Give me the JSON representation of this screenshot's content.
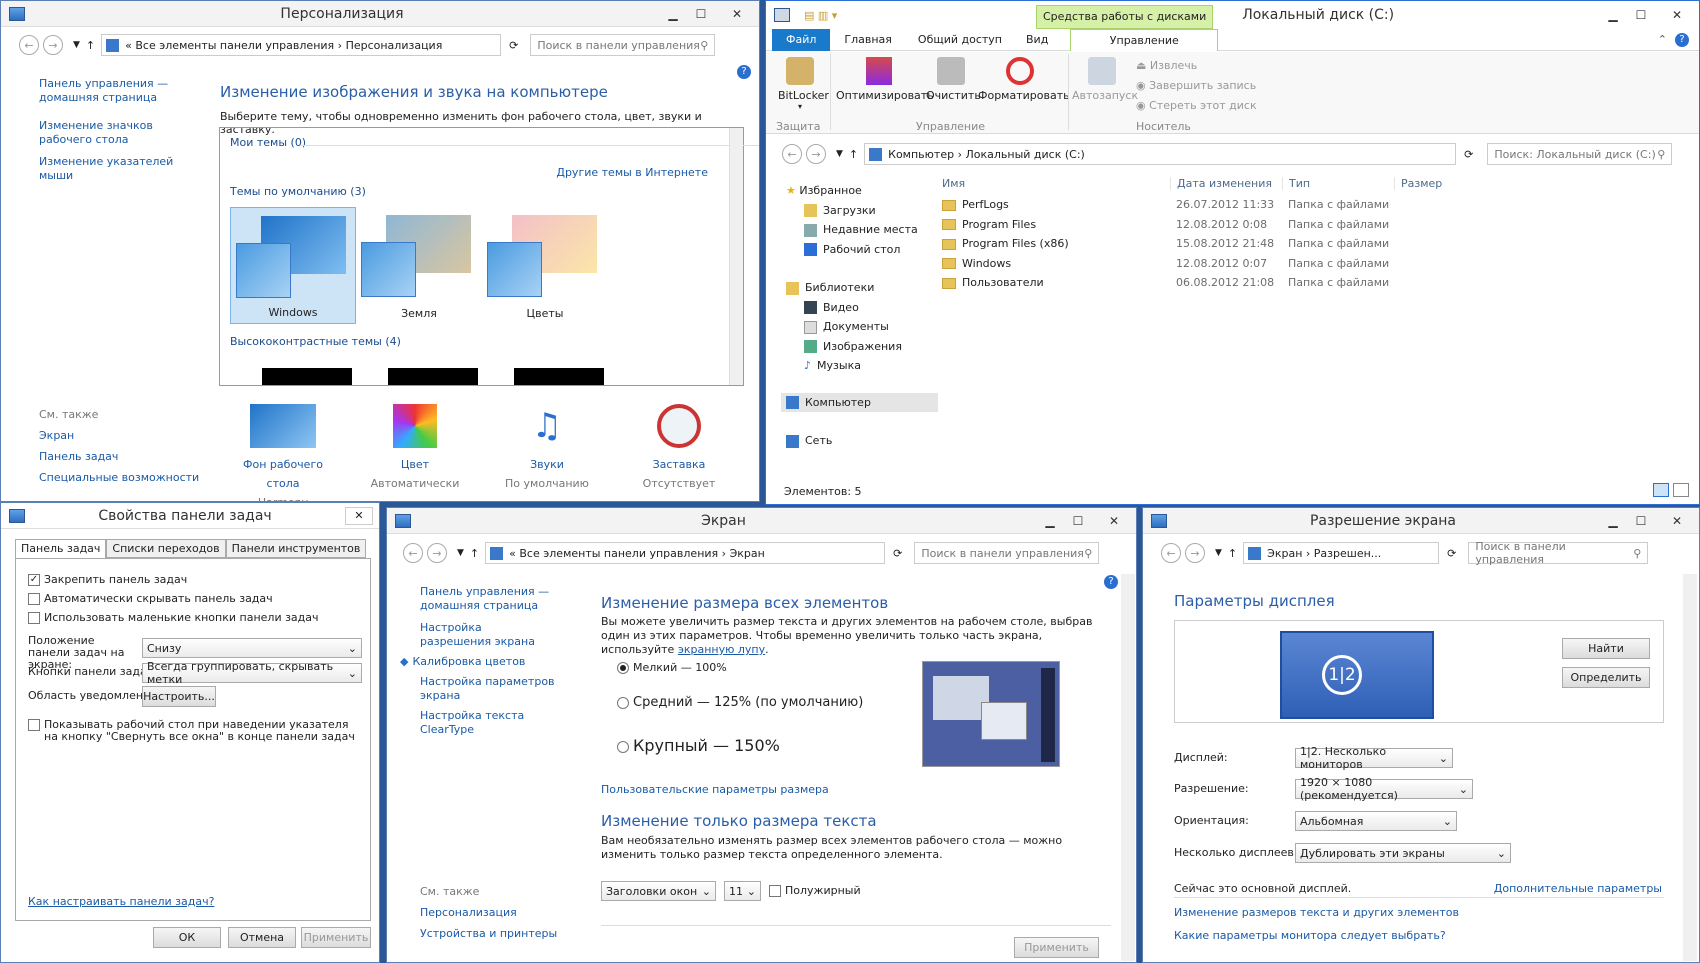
{
  "personalization": {
    "title": "Персонализация",
    "breadcrumb": [
      "Все элементы панели управления",
      "Персонализация"
    ],
    "search_placeholder": "Поиск в панели управления",
    "left_links": [
      "Панель управления — домашняя страница",
      "Изменение значков рабочего стола",
      "Изменение указателей мыши"
    ],
    "see_also_title": "См. также",
    "see_also": [
      "Экран",
      "Панель задач",
      "Специальные возможности"
    ],
    "heading": "Изменение изображения и звука на компьютере",
    "subheading": "Выберите тему, чтобы одновременно изменить фон рабочего стола, цвет, звуки и заставку.",
    "my_themes": "Мои темы (0)",
    "more_online": "Другие темы в Интернете",
    "default_themes": "Темы по умолчанию (3)",
    "themes": [
      "Windows",
      "Земля",
      "Цветы"
    ],
    "high_contrast": "Высококонтрастные темы (4)",
    "bottom_items": [
      {
        "label": "Фон рабочего стола",
        "value": "Harmony"
      },
      {
        "label": "Цвет",
        "value": "Автоматически"
      },
      {
        "label": "Звуки",
        "value": "По умолчанию"
      },
      {
        "label": "Заставка",
        "value": "Отсутствует"
      }
    ]
  },
  "explorer": {
    "title": "Локальный диск (C:)",
    "context_tab": "Средства работы с дисками",
    "tabs": [
      "Файл",
      "Главная",
      "Общий доступ",
      "Вид",
      "Управление"
    ],
    "ribbon": {
      "bitlocker": "BitLocker",
      "optimize": "Оптимизировать",
      "cleanup": "Очистить",
      "format": "Форматировать",
      "autoplay": "Автозапуск",
      "eject": "Извлечь",
      "finish_burn": "Завершить запись",
      "erase": "Стереть этот диск",
      "group_protect": "Защита",
      "group_manage": "Управление",
      "group_media": "Носитель"
    },
    "breadcrumb": [
      "Компьютер",
      "Локальный диск (C:)"
    ],
    "search_placeholder": "Поиск: Локальный диск (C:)",
    "nav": {
      "favorites": "Избранное",
      "fav_items": [
        "Загрузки",
        "Недавние места",
        "Рабочий стол"
      ],
      "libraries": "Библиотеки",
      "lib_items": [
        "Видео",
        "Документы",
        "Изображения",
        "Музыка"
      ],
      "computer": "Компьютер",
      "network": "Сеть"
    },
    "columns": [
      "Имя",
      "Дата изменения",
      "Тип",
      "Размер"
    ],
    "rows": [
      {
        "name": "PerfLogs",
        "date": "26.07.2012 11:33",
        "type": "Папка с файлами"
      },
      {
        "name": "Program Files",
        "date": "12.08.2012 0:08",
        "type": "Папка с файлами"
      },
      {
        "name": "Program Files (x86)",
        "date": "15.08.2012 21:48",
        "type": "Папка с файлами"
      },
      {
        "name": "Windows",
        "date": "12.08.2012 0:07",
        "type": "Папка с файлами"
      },
      {
        "name": "Пользователи",
        "date": "06.08.2012 21:08",
        "type": "Папка с файлами"
      }
    ],
    "status": "Элементов: 5"
  },
  "taskbar_props": {
    "title": "Свойства панели задач",
    "tabs": [
      "Панель задач",
      "Списки переходов",
      "Панели инструментов"
    ],
    "chk_lock": "Закрепить панель задач",
    "chk_autohide": "Автоматически скрывать панель задач",
    "chk_small": "Использовать маленькие кнопки панели задач",
    "position_label": "Положение панели задач на экране:",
    "position_value": "Снизу",
    "buttons_label": "Кнопки панели задач:",
    "buttons_value": "Всегда группировать, скрывать метки",
    "notify_label": "Область уведомлений:",
    "notify_button": "Настроить...",
    "peek_label": "Показывать рабочий стол при наведении указателя на кнопку \"Свернуть все окна\" в конце панели задач",
    "help_link": "Как настраивать панели задач?",
    "ok": "ОК",
    "cancel": "Отмена",
    "apply": "Применить"
  },
  "display": {
    "title": "Экран",
    "breadcrumb": [
      "Все элементы панели управления",
      "Экран"
    ],
    "search_placeholder": "Поиск в панели управления",
    "left_links": [
      "Панель управления — домашняя страница",
      "Настройка разрешения экрана",
      "Калибровка цветов",
      "Настройка параметров экрана",
      "Настройка текста ClearType"
    ],
    "see_also_title": "См. также",
    "see_also": [
      "Персонализация",
      "Устройства и принтеры"
    ],
    "heading1": "Изменение размера всех элементов",
    "desc1": "Вы можете увеличить размер текста и других элементов на рабочем столе, выбрав один из этих параметров. Чтобы временно увеличить только часть экрана, используйте",
    "magnifier_link": "экранную лупу",
    "opt_small": "Мелкий — 100%",
    "opt_medium": "Средний — 125% (по умолчанию)",
    "opt_large": "Крупный — 150%",
    "custom_link": "Пользовательские параметры размера",
    "heading2": "Изменение только размера текста",
    "desc2": "Вам необязательно изменять размер всех элементов рабочего стола — можно изменить только размер текста определенного элемента.",
    "element_value": "Заголовки окон",
    "size_value": "11",
    "bold_label": "Полужирный",
    "apply": "Применить"
  },
  "resolution": {
    "title": "Разрешение экрана",
    "breadcrumb": [
      "Экран",
      "Разрешен..."
    ],
    "search_placeholder": "Поиск в панели управления",
    "heading": "Параметры дисплея",
    "monitor_label": "1|2",
    "find": "Найти",
    "identify": "Определить",
    "display_label": "Дисплей:",
    "display_value": "1|2. Несколько мониторов",
    "resolution_label": "Разрешение:",
    "resolution_value": "1920 × 1080 (рекомендуется)",
    "orientation_label": "Ориентация:",
    "orientation_value": "Альбомная",
    "multi_label": "Несколько дисплеев:",
    "multi_value": "Дублировать эти экраны",
    "main_display": "Сейчас это основной дисплей.",
    "advanced": "Дополнительные параметры",
    "link1": "Изменение размеров текста и других элементов",
    "link2": "Какие параметры монитора следует выбрать?"
  }
}
